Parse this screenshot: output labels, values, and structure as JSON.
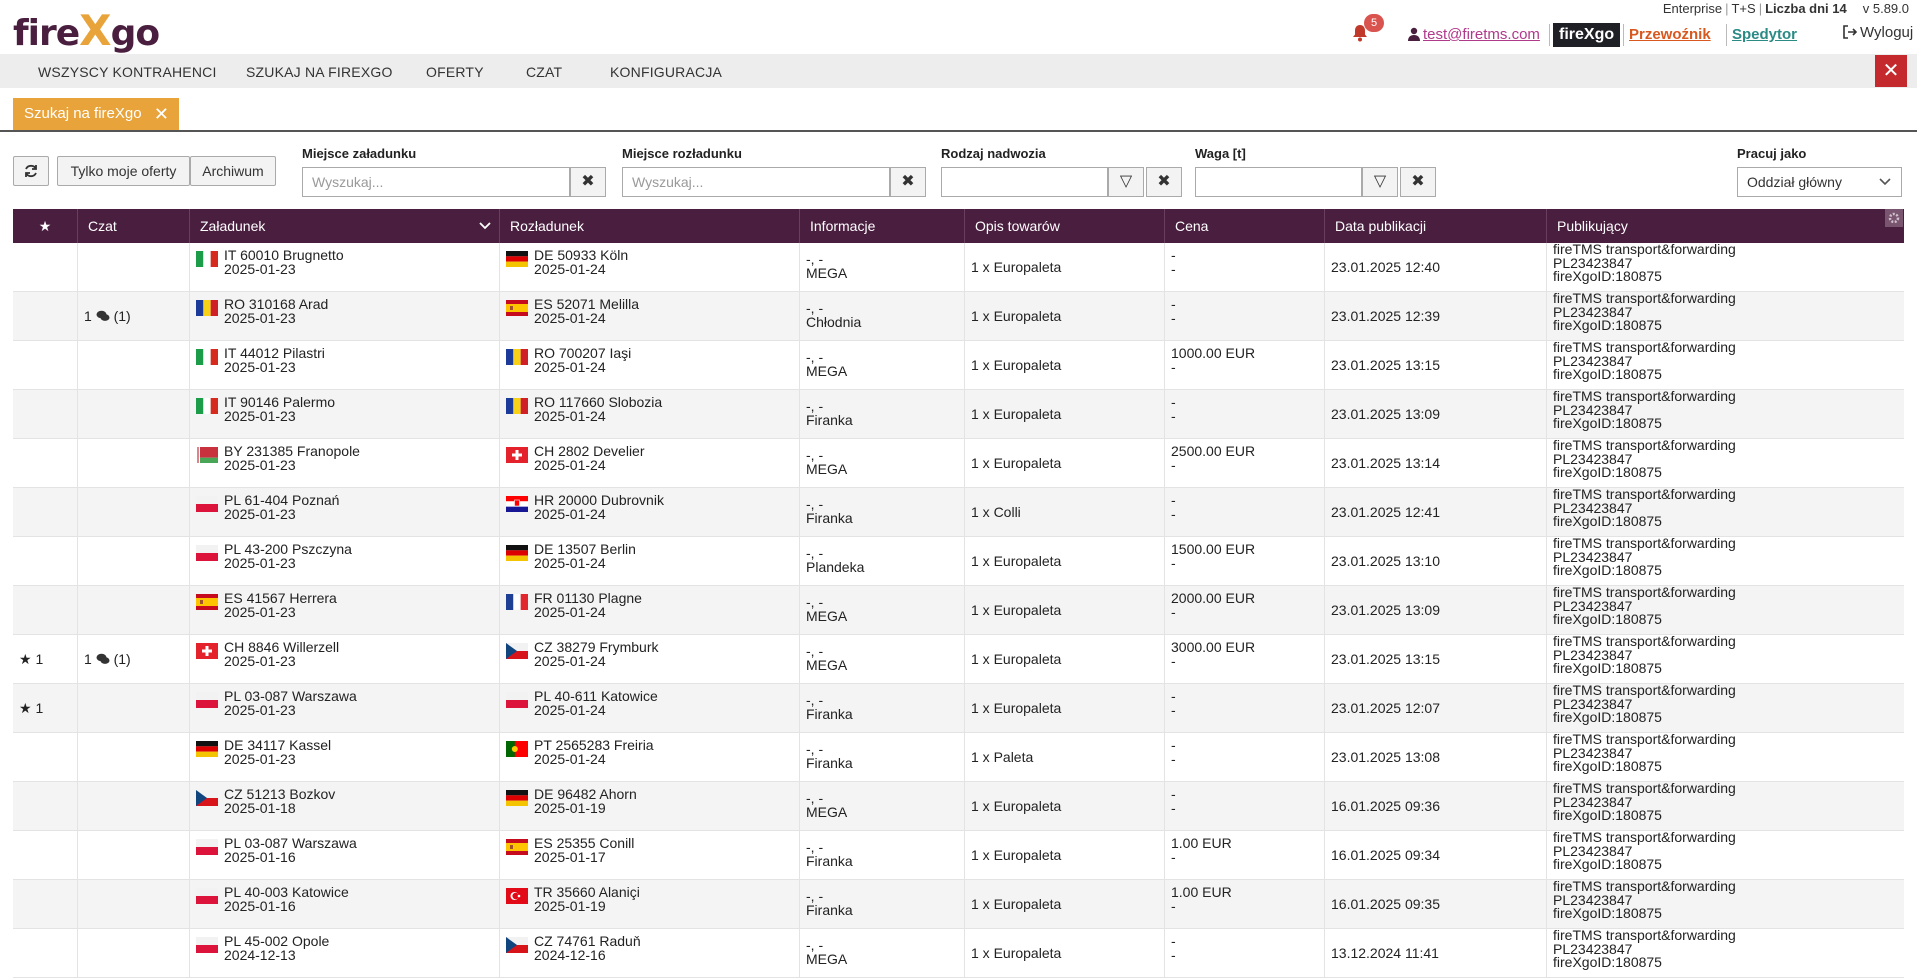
{
  "header": {
    "logo_left": "fire",
    "logo_x": "X",
    "logo_right": "go",
    "plan": "Enterprise",
    "mode": "T+S",
    "days_label": "Liczba dni 14",
    "version": "v 5.89.0",
    "notifications_count": "5",
    "user_email": "test@firetms.com",
    "badge": "fireXgo",
    "carrier_link": "Przewoźnik",
    "forwarder_link": "Spedytor",
    "logout": "Wyloguj"
  },
  "nav": {
    "items": [
      "WSZYSCY KONTRAHENCI",
      "SZUKAJ NA FIREXGO",
      "OFERTY",
      "CZAT",
      "KONFIGURACJA"
    ],
    "close": "✕"
  },
  "tab": {
    "label": "Szukaj na fireXgo",
    "close": "✕"
  },
  "filters": {
    "only_mine": "Tylko moje oferty",
    "archive": "Archiwum",
    "loading_label": "Miejsce załadunku",
    "loading_placeholder": "Wyszukaj...",
    "unloading_label": "Miejsce rozładunku",
    "unloading_placeholder": "Wyszukaj...",
    "body_label": "Rodzaj nadwozia",
    "weight_label": "Waga [t]",
    "work_as_label": "Pracuj jako",
    "work_as_value": "Oddział główny"
  },
  "columns": [
    "★",
    "Czat",
    "Załadunek",
    "Rozładunek",
    "Informacje",
    "Opis towarów",
    "Cena",
    "Data publikacji",
    "Publikujący"
  ],
  "rows": [
    {
      "star": "",
      "chat": "",
      "lf": "it",
      "load": "IT 60010 Brugnetto",
      "ld": "2025-01-23",
      "uf": "de",
      "unload": "DE 50933 Köln",
      "ud": "2025-01-24",
      "info1": "-, -",
      "info2": "MEGA",
      "goods": "1 x Europaleta",
      "price1": "-",
      "price2": "-",
      "date": "23.01.2025 12:40",
      "p1": "fireTMS transport&forwarding",
      "p2": "PL23423847",
      "p3": "fireXgoID:180875"
    },
    {
      "star": "",
      "chat": "1 💬 (1)",
      "lf": "ro",
      "load": "RO 310168 Arad",
      "ld": "2025-01-23",
      "uf": "es",
      "unload": "ES 52071 Melilla",
      "ud": "2025-01-24",
      "info1": "-, -",
      "info2": "Chłodnia",
      "goods": "1 x Europaleta",
      "price1": "-",
      "price2": "-",
      "date": "23.01.2025 12:39",
      "p1": "fireTMS transport&forwarding",
      "p2": "PL23423847",
      "p3": "fireXgoID:180875"
    },
    {
      "star": "",
      "chat": "",
      "lf": "it",
      "load": "IT 44012 Pilastri",
      "ld": "2025-01-23",
      "uf": "ro",
      "unload": "RO 700207 Iaşi",
      "ud": "2025-01-24",
      "info1": "-, -",
      "info2": "MEGA",
      "goods": "1 x Europaleta",
      "price1": "1000.00 EUR",
      "price2": "-",
      "date": "23.01.2025 13:15",
      "p1": "fireTMS transport&forwarding",
      "p2": "PL23423847",
      "p3": "fireXgoID:180875"
    },
    {
      "star": "",
      "chat": "",
      "lf": "it",
      "load": "IT 90146 Palermo",
      "ld": "2025-01-23",
      "uf": "ro",
      "unload": "RO 117660 Slobozia",
      "ud": "2025-01-24",
      "info1": "-, -",
      "info2": "Firanka",
      "goods": "1 x Europaleta",
      "price1": "-",
      "price2": "-",
      "date": "23.01.2025 13:09",
      "p1": "fireTMS transport&forwarding",
      "p2": "PL23423847",
      "p3": "fireXgoID:180875"
    },
    {
      "star": "",
      "chat": "",
      "lf": "by",
      "load": "BY 231385 Franopole",
      "ld": "2025-01-23",
      "uf": "ch",
      "unload": "CH 2802 Develier",
      "ud": "2025-01-24",
      "info1": "-, -",
      "info2": "MEGA",
      "goods": "1 x Europaleta",
      "price1": "2500.00 EUR",
      "price2": "-",
      "date": "23.01.2025 13:14",
      "p1": "fireTMS transport&forwarding",
      "p2": "PL23423847",
      "p3": "fireXgoID:180875"
    },
    {
      "star": "",
      "chat": "",
      "lf": "pl",
      "load": "PL 61-404 Poznań",
      "ld": "2025-01-23",
      "uf": "hr",
      "unload": "HR 20000 Dubrovnik",
      "ud": "2025-01-24",
      "info1": "-, -",
      "info2": "Firanka",
      "goods": "1 x Colli",
      "price1": "-",
      "price2": "-",
      "date": "23.01.2025 12:41",
      "p1": "fireTMS transport&forwarding",
      "p2": "PL23423847",
      "p3": "fireXgoID:180875"
    },
    {
      "star": "",
      "chat": "",
      "lf": "pl",
      "load": "PL 43-200 Pszczyna",
      "ld": "2025-01-23",
      "uf": "de",
      "unload": "DE 13507 Berlin",
      "ud": "2025-01-24",
      "info1": "-, -",
      "info2": "Plandeka",
      "goods": "1 x Europaleta",
      "price1": "1500.00 EUR",
      "price2": "-",
      "date": "23.01.2025 13:10",
      "p1": "fireTMS transport&forwarding",
      "p2": "PL23423847",
      "p3": "fireXgoID:180875"
    },
    {
      "star": "",
      "chat": "",
      "lf": "es",
      "load": "ES 41567 Herrera",
      "ld": "2025-01-23",
      "uf": "fr",
      "unload": "FR 01130 Plagne",
      "ud": "2025-01-24",
      "info1": "-, -",
      "info2": "MEGA",
      "goods": "1 x Europaleta",
      "price1": "2000.00 EUR",
      "price2": "-",
      "date": "23.01.2025 13:09",
      "p1": "fireTMS transport&forwarding",
      "p2": "PL23423847",
      "p3": "fireXgoID:180875"
    },
    {
      "star": "★ 1",
      "chat": "1 💬 (1)",
      "lf": "ch",
      "load": "CH 8846 Willerzell",
      "ld": "2025-01-23",
      "uf": "cz",
      "unload": "CZ 38279 Frymburk",
      "ud": "2025-01-24",
      "info1": "-, -",
      "info2": "MEGA",
      "goods": "1 x Europaleta",
      "price1": "3000.00 EUR",
      "price2": "-",
      "date": "23.01.2025 13:15",
      "p1": "fireTMS transport&forwarding",
      "p2": "PL23423847",
      "p3": "fireXgoID:180875"
    },
    {
      "star": "★ 1",
      "chat": "",
      "lf": "pl",
      "load": "PL 03-087 Warszawa",
      "ld": "2025-01-23",
      "uf": "pl",
      "unload": "PL 40-611 Katowice",
      "ud": "2025-01-24",
      "info1": "-, -",
      "info2": "Firanka",
      "goods": "1 x Europaleta",
      "price1": "-",
      "price2": "-",
      "date": "23.01.2025 12:07",
      "p1": "fireTMS transport&forwarding",
      "p2": "PL23423847",
      "p3": "fireXgoID:180875"
    },
    {
      "star": "",
      "chat": "",
      "lf": "de",
      "load": "DE 34117 Kassel",
      "ld": "2025-01-23",
      "uf": "pt",
      "unload": "PT 2565283 Freiria",
      "ud": "2025-01-24",
      "info1": "-, -",
      "info2": "Firanka",
      "goods": "1 x Paleta",
      "price1": "-",
      "price2": "-",
      "date": "23.01.2025 13:08",
      "p1": "fireTMS transport&forwarding",
      "p2": "PL23423847",
      "p3": "fireXgoID:180875"
    },
    {
      "star": "",
      "chat": "",
      "lf": "cz",
      "load": "CZ 51213 Bozkov",
      "ld": "2025-01-18",
      "uf": "de",
      "unload": "DE 96482 Ahorn",
      "ud": "2025-01-19",
      "info1": "-, -",
      "info2": "MEGA",
      "goods": "1 x Europaleta",
      "price1": "-",
      "price2": "-",
      "date": "16.01.2025 09:36",
      "p1": "fireTMS transport&forwarding",
      "p2": "PL23423847",
      "p3": "fireXgoID:180875"
    },
    {
      "star": "",
      "chat": "",
      "lf": "pl",
      "load": "PL 03-087 Warszawa",
      "ld": "2025-01-16",
      "uf": "es",
      "unload": "ES 25355 Conill",
      "ud": "2025-01-17",
      "info1": "-, -",
      "info2": "Firanka",
      "goods": "1 x Europaleta",
      "price1": "1.00 EUR",
      "price2": "-",
      "date": "16.01.2025 09:34",
      "p1": "fireTMS transport&forwarding",
      "p2": "PL23423847",
      "p3": "fireXgoID:180875"
    },
    {
      "star": "",
      "chat": "",
      "lf": "pl",
      "load": "PL 40-003 Katowice",
      "ld": "2025-01-16",
      "uf": "tr",
      "unload": "TR 35660 Alaniçi",
      "ud": "2025-01-19",
      "info1": "-, -",
      "info2": "Firanka",
      "goods": "1 x Europaleta",
      "price1": "1.00 EUR",
      "price2": "-",
      "date": "16.01.2025 09:35",
      "p1": "fireTMS transport&forwarding",
      "p2": "PL23423847",
      "p3": "fireXgoID:180875"
    },
    {
      "star": "",
      "chat": "",
      "lf": "pl",
      "load": "PL 45-002 Opole",
      "ld": "2024-12-13",
      "uf": "cz",
      "unload": "CZ 74761 Raduň",
      "ud": "2024-12-16",
      "info1": "-, -",
      "info2": "MEGA",
      "goods": "1 x Europaleta",
      "price1": "-",
      "price2": "-",
      "date": "13.12.2024 11:41",
      "p1": "fireTMS transport&forwarding",
      "p2": "PL23423847",
      "p3": "fireXgoID:180875"
    }
  ],
  "colors": {
    "brand": "#4a1e3f",
    "tab": "#e8a33a",
    "close": "#c42a2d",
    "carrier": "#d9581f",
    "forwarder": "#2a8a84"
  }
}
